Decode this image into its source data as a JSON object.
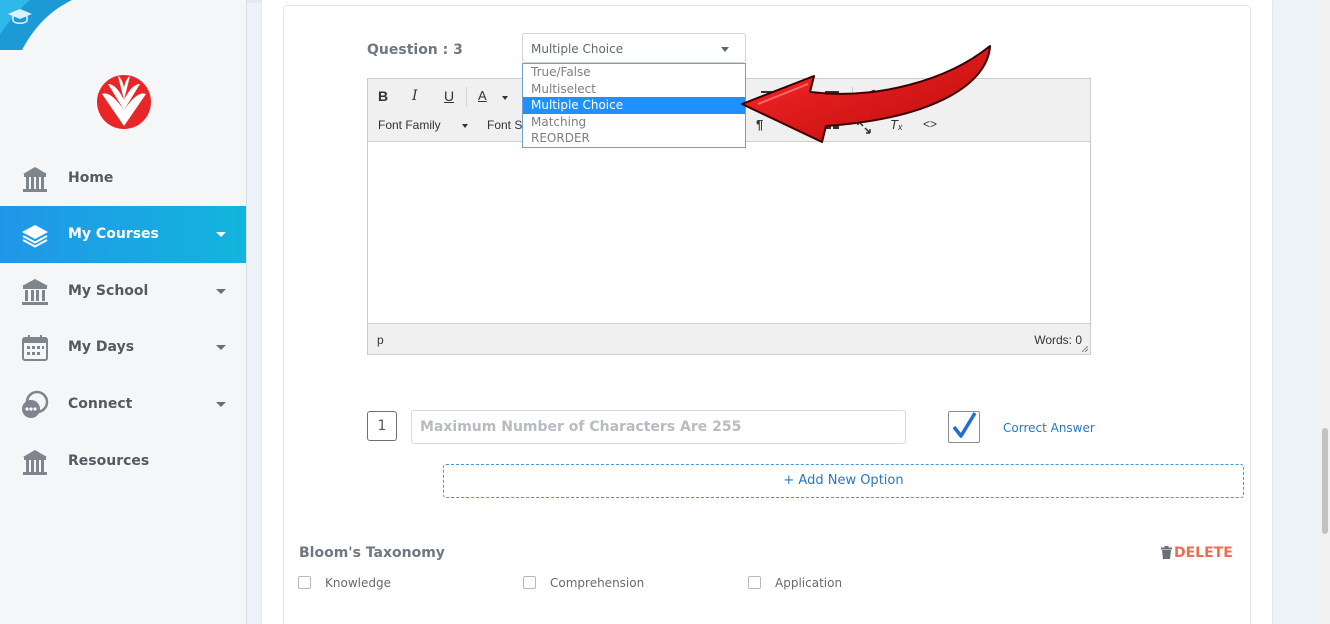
{
  "sidebar": {
    "items": [
      {
        "label": "Home",
        "icon": "school-building-icon",
        "active": false,
        "has_dropdown": false
      },
      {
        "label": "My Courses",
        "icon": "layers-stack-icon",
        "active": true,
        "has_dropdown": true
      },
      {
        "label": "My School",
        "icon": "columns-building-icon",
        "active": false,
        "has_dropdown": true
      },
      {
        "label": "My Days",
        "icon": "calendar-icon",
        "active": false,
        "has_dropdown": true
      },
      {
        "label": "Connect",
        "icon": "chat-bubbles-icon",
        "active": false,
        "has_dropdown": true
      },
      {
        "label": "Resources",
        "icon": "library-building-icon",
        "active": false,
        "has_dropdown": false
      }
    ]
  },
  "question": {
    "label": "Question : 3",
    "type_select": {
      "value": "Multiple Choice",
      "options": [
        "True/False",
        "Multiselect",
        "Multiple Choice",
        "Matching",
        "REORDER"
      ],
      "highlighted": "Multiple Choice"
    }
  },
  "editor": {
    "toolbar": {
      "bold": "B",
      "italic": "I",
      "underline": "U",
      "font_color": "A",
      "font_family": "Font Family",
      "font_size": "Font S"
    },
    "status_path": "p",
    "word_count": "Words: 0"
  },
  "option": {
    "number": "1",
    "placeholder": "Maximum Number of Characters Are 255",
    "correct_checked": true,
    "correct_label": "Correct Answer"
  },
  "add_option_label": "+ Add New Option",
  "bloom": {
    "title": "Bloom's Taxonomy",
    "delete_label": "DELETE",
    "levels": [
      "Knowledge",
      "Comprehension",
      "Application"
    ]
  },
  "colors": {
    "active_nav_start": "#2196e8",
    "active_nav_end": "#12b5dd",
    "link_blue": "#2678c6",
    "delete_red": "#f06b4f",
    "arrow_red": "#d81616",
    "logo_red": "#e8262a"
  }
}
